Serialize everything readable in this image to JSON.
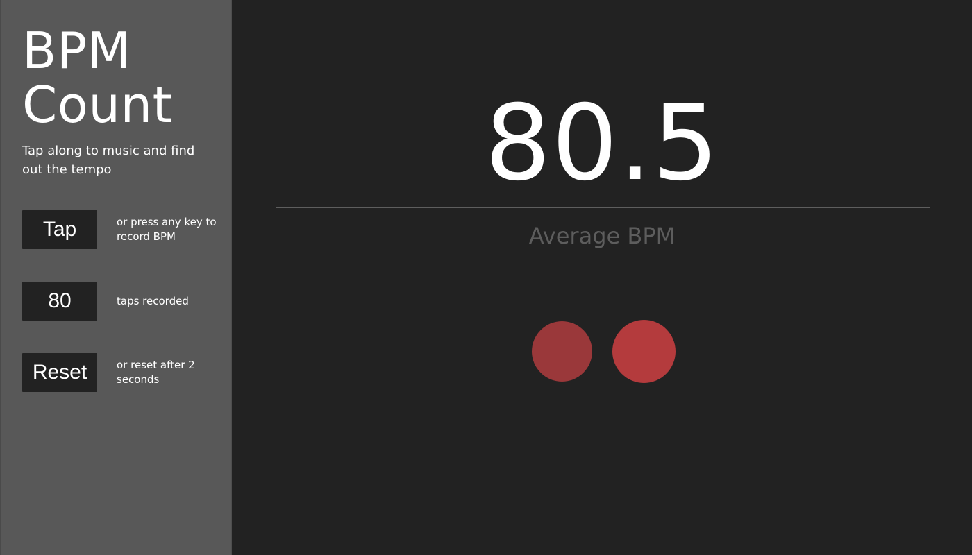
{
  "sidebar": {
    "title_line1": "BPM",
    "title_line2": "Count",
    "subtitle": "Tap along to music and find out the tempo",
    "tap": {
      "button_label": "Tap",
      "note": "or press any key to record BPM"
    },
    "taps": {
      "count": "80",
      "note": "taps recorded"
    },
    "reset": {
      "button_label": "Reset",
      "note": "or reset after 2 seconds"
    }
  },
  "main": {
    "bpm_value": "80.5",
    "bpm_label": "Average BPM"
  },
  "beat_indicators": [
    {
      "name": "beat-dot-left",
      "color": "#9a383a"
    },
    {
      "name": "beat-dot-right",
      "color": "#b43b3d"
    }
  ],
  "colors": {
    "sidebar_bg": "#585858",
    "main_bg": "#222222",
    "text": "#ffffff",
    "muted_label": "#5d5d5d"
  }
}
